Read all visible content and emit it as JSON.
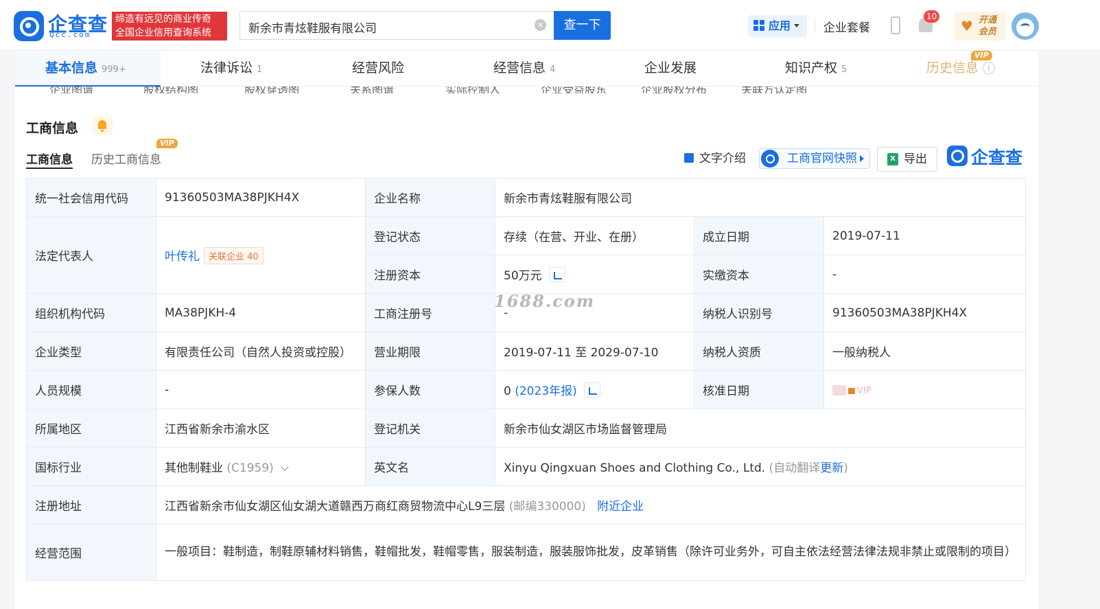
{
  "header": {
    "logo_text": "企查查",
    "logo_sub": "Qcc.com",
    "slogan_line1": "缔造有远见的商业传奇",
    "slogan_line2": "全国企业信用查询系统",
    "search_value": "新余市青炫鞋服有限公司",
    "search_button": "查一下",
    "apps_label": "应用",
    "package_label": "企业套餐",
    "notification_count": "10",
    "member_line1": "开通",
    "member_line2": "会员"
  },
  "tabs": [
    {
      "label": "基本信息",
      "count": "999+"
    },
    {
      "label": "法律诉讼",
      "count": "1"
    },
    {
      "label": "经营风险",
      "count": ""
    },
    {
      "label": "经营信息",
      "count": "4"
    },
    {
      "label": "企业发展",
      "count": ""
    },
    {
      "label": "知识产权",
      "count": "5"
    },
    {
      "label": "历史信息",
      "count": ""
    }
  ],
  "vip_label": "VIP",
  "subnav": [
    "企业图谱",
    "股权结构图",
    "股权穿透图",
    "关系图谱",
    "实际控制人",
    "企业受益股东",
    "企业股权分布",
    "关联方认定图"
  ],
  "section": {
    "title": "工商信息",
    "subtab_active": "工商信息",
    "subtab_history": "历史工商信息",
    "tool_intro": "文字介绍",
    "tool_snapshot": "工商官网快照",
    "tool_export": "导出",
    "brand": "企查查"
  },
  "table": {
    "credit_code_label": "统一社会信用代码",
    "credit_code": "91360503MA38PJKH4X",
    "company_name_label": "企业名称",
    "company_name": "新余市青炫鞋服有限公司",
    "legal_rep_label": "法定代表人",
    "legal_rep": "叶传礼",
    "assoc_label": "关联企业",
    "assoc_count": "40",
    "reg_status_label": "登记状态",
    "reg_status": "存续（在营、开业、在册）",
    "est_date_label": "成立日期",
    "est_date": "2019-07-11",
    "reg_capital_label": "注册资本",
    "reg_capital": "50万元",
    "paid_capital_label": "实缴资本",
    "paid_capital": "-",
    "org_code_label": "组织机构代码",
    "org_code": "MA38PJKH-4",
    "biz_reg_no_label": "工商注册号",
    "biz_reg_no": "-",
    "taxpayer_id_label": "纳税人识别号",
    "taxpayer_id": "91360503MA38PJKH4X",
    "company_type_label": "企业类型",
    "company_type": "有限责任公司（自然人投资或控股）",
    "biz_term_label": "营业期限",
    "biz_term": "2019-07-11 至 2029-07-10",
    "taxpayer_qual_label": "纳税人资质",
    "taxpayer_qual": "一般纳税人",
    "staff_size_label": "人员规模",
    "staff_size": "-",
    "insured_label": "参保人数",
    "insured": "0",
    "insured_year": "(2023年报)",
    "approval_date_label": "核准日期",
    "approval_date_vip": "VIP",
    "region_label": "所属地区",
    "region": "江西省新余市渝水区",
    "reg_authority_label": "登记机关",
    "reg_authority": "新余市仙女湖区市场监督管理局",
    "industry_label": "国标行业",
    "industry": "其他制鞋业",
    "industry_code": "(C1959)",
    "english_name_label": "英文名",
    "english_name": "Xinyu Qingxuan Shoes and Clothing Co., Ltd.",
    "english_note_prefix": "(自动翻译",
    "english_note_link": "更新",
    "english_note_suffix": ")",
    "address_label": "注册地址",
    "address": "江西省新余市仙女湖区仙女湖大道赣西万商红商贸物流中心L9三层",
    "postcode": "(邮编330000)",
    "nearby": "附近企业",
    "scope_label": "经营范围",
    "scope": "一般项目：鞋制造，制鞋原辅材料销售，鞋帽批发，鞋帽零售，服装制造，服装服饰批发，皮革销售（除许可业务外，可自主依法经营法律法规非禁止或限制的项目）"
  },
  "watermark": "1688.com"
}
